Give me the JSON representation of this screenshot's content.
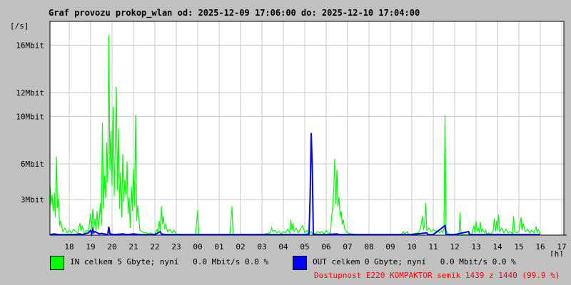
{
  "chart_data": {
    "type": "line",
    "title": "Graf provozu prokop_wlan od: 2025-12-09 17:06:00 do: 2025-12-10 17:04:00",
    "ylabel": "[/s]",
    "xlabel": "[h]",
    "ylim": [
      0,
      18
    ],
    "y_ticks": [
      {
        "value": 3,
        "label": "3Mbit"
      },
      {
        "value": 6,
        "label": "6Mbit"
      },
      {
        "value": 10,
        "label": "10Mbit"
      },
      {
        "value": 12,
        "label": "12Mbit"
      },
      {
        "value": 16,
        "label": "16Mbit"
      }
    ],
    "xlim": [
      17.1,
      17.1
    ],
    "x_hours": [
      "18",
      "19",
      "20",
      "21",
      "22",
      "23",
      "00",
      "01",
      "02",
      "03",
      "04",
      "05",
      "06",
      "07",
      "08",
      "09",
      "10",
      "11",
      "12",
      "13",
      "14",
      "15",
      "16",
      "17"
    ],
    "grid": true,
    "series": [
      {
        "name": "IN",
        "color": "#00ff00",
        "unit": "Mbit/s",
        "points": [
          [
            17.1,
            4.2
          ],
          [
            17.15,
            2.5
          ],
          [
            17.2,
            3.4
          ],
          [
            17.25,
            2.0
          ],
          [
            17.3,
            3.6
          ],
          [
            17.35,
            1.5
          ],
          [
            17.4,
            6.6
          ],
          [
            17.45,
            2.3
          ],
          [
            17.5,
            3.1
          ],
          [
            17.55,
            0.8
          ],
          [
            17.6,
            1.2
          ],
          [
            17.7,
            0.3
          ],
          [
            17.8,
            0.6
          ],
          [
            17.9,
            0.2
          ],
          [
            18.0,
            0.4
          ],
          [
            18.1,
            0.2
          ],
          [
            18.2,
            0.5
          ],
          [
            18.3,
            0.3
          ],
          [
            18.4,
            0.2
          ],
          [
            18.5,
            1.0
          ],
          [
            18.55,
            0.3
          ],
          [
            18.6,
            0.8
          ],
          [
            18.7,
            0.2
          ],
          [
            18.8,
            0.4
          ],
          [
            18.9,
            0.3
          ],
          [
            19.0,
            1.8
          ],
          [
            19.05,
            0.5
          ],
          [
            19.1,
            2.2
          ],
          [
            19.15,
            0.6
          ],
          [
            19.2,
            1.4
          ],
          [
            19.25,
            0.4
          ],
          [
            19.3,
            2.0
          ],
          [
            19.35,
            0.5
          ],
          [
            19.4,
            1.3
          ],
          [
            19.45,
            2.7
          ],
          [
            19.5,
            0.8
          ],
          [
            19.55,
            9.5
          ],
          [
            19.6,
            2.2
          ],
          [
            19.65,
            5.0
          ],
          [
            19.7,
            3.1
          ],
          [
            19.75,
            7.8
          ],
          [
            19.8,
            4.4
          ],
          [
            19.85,
            16.8
          ],
          [
            19.9,
            5.5
          ],
          [
            19.95,
            8.8
          ],
          [
            20.0,
            4.2
          ],
          [
            20.05,
            10.8
          ],
          [
            20.1,
            3.3
          ],
          [
            20.15,
            7.5
          ],
          [
            20.2,
            12.5
          ],
          [
            20.25,
            3.8
          ],
          [
            20.3,
            9.0
          ],
          [
            20.35,
            2.2
          ],
          [
            20.4,
            5.3
          ],
          [
            20.45,
            1.5
          ],
          [
            20.5,
            6.8
          ],
          [
            20.55,
            2.8
          ],
          [
            20.6,
            4.7
          ],
          [
            20.65,
            3.4
          ],
          [
            20.7,
            6.2
          ],
          [
            20.75,
            1.8
          ],
          [
            20.8,
            3.2
          ],
          [
            20.85,
            0.6
          ],
          [
            20.9,
            4.1
          ],
          [
            20.95,
            2.0
          ],
          [
            21.0,
            5.6
          ],
          [
            21.05,
            2.4
          ],
          [
            21.1,
            10.1
          ],
          [
            21.15,
            1.2
          ],
          [
            21.2,
            2.5
          ],
          [
            21.3,
            0.4
          ],
          [
            21.4,
            0.3
          ],
          [
            21.5,
            0.2
          ],
          [
            21.6,
            0.2
          ],
          [
            21.7,
            0.1
          ],
          [
            21.8,
            0.2
          ],
          [
            21.9,
            0.1
          ],
          [
            22.0,
            0.1
          ],
          [
            22.1,
            0.5
          ],
          [
            22.15,
            0.2
          ],
          [
            22.2,
            1.2
          ],
          [
            22.25,
            0.4
          ],
          [
            22.3,
            2.4
          ],
          [
            22.35,
            0.9
          ],
          [
            22.4,
            1.6
          ],
          [
            22.45,
            0.5
          ],
          [
            22.5,
            0.9
          ],
          [
            22.6,
            0.3
          ],
          [
            22.7,
            0.5
          ],
          [
            22.8,
            0.2
          ],
          [
            22.9,
            0.4
          ],
          [
            23.0,
            0.1
          ],
          [
            23.2,
            0.05
          ],
          [
            23.5,
            0.05
          ],
          [
            23.9,
            0.05
          ],
          [
            24.0,
            2.1
          ],
          [
            24.05,
            0.05
          ],
          [
            24.5,
            0.05
          ],
          [
            25.0,
            0.05
          ],
          [
            25.5,
            0.05
          ],
          [
            25.6,
            2.4
          ],
          [
            25.65,
            0.05
          ],
          [
            26.0,
            0.05
          ],
          [
            26.5,
            0.05
          ],
          [
            27.0,
            0.05
          ],
          [
            27.4,
            0.2
          ],
          [
            27.45,
            0.6
          ],
          [
            27.5,
            0.3
          ],
          [
            27.6,
            0.4
          ],
          [
            27.7,
            0.2
          ],
          [
            27.8,
            0.3
          ],
          [
            27.9,
            0.1
          ],
          [
            28.0,
            0.3
          ],
          [
            28.1,
            0.2
          ],
          [
            28.2,
            0.5
          ],
          [
            28.3,
            0.2
          ],
          [
            28.35,
            1.3
          ],
          [
            28.4,
            0.4
          ],
          [
            28.45,
            1.0
          ],
          [
            28.5,
            0.3
          ],
          [
            28.6,
            0.6
          ],
          [
            28.7,
            0.2
          ],
          [
            28.8,
            0.5
          ],
          [
            28.9,
            0.8
          ],
          [
            29.0,
            0.2
          ],
          [
            29.1,
            0.4
          ],
          [
            29.2,
            0.1
          ],
          [
            29.3,
            0.3
          ],
          [
            29.35,
            0.1
          ],
          [
            29.4,
            0.2
          ],
          [
            29.5,
            0.1
          ],
          [
            29.6,
            0.3
          ],
          [
            29.7,
            0.2
          ],
          [
            29.8,
            0.3
          ],
          [
            29.9,
            0.1
          ],
          [
            30.0,
            0.4
          ],
          [
            30.1,
            0.2
          ],
          [
            30.2,
            0.1
          ],
          [
            30.25,
            1.5
          ],
          [
            30.3,
            2.2
          ],
          [
            30.35,
            3.8
          ],
          [
            30.4,
            6.4
          ],
          [
            30.45,
            2.6
          ],
          [
            30.5,
            5.5
          ],
          [
            30.55,
            2.4
          ],
          [
            30.6,
            3.2
          ],
          [
            30.65,
            1.6
          ],
          [
            30.7,
            2.0
          ],
          [
            30.75,
            0.9
          ],
          [
            30.8,
            1.3
          ],
          [
            30.85,
            0.6
          ],
          [
            30.9,
            0.4
          ],
          [
            31.0,
            0.2
          ],
          [
            31.2,
            0.1
          ],
          [
            31.5,
            0.05
          ],
          [
            32.0,
            0.05
          ],
          [
            32.5,
            0.05
          ],
          [
            33.0,
            0.05
          ],
          [
            33.5,
            0.05
          ],
          [
            33.6,
            0.3
          ],
          [
            33.65,
            0.1
          ],
          [
            33.8,
            0.3
          ],
          [
            33.85,
            0.05
          ],
          [
            34.0,
            0.1
          ],
          [
            34.3,
            0.2
          ],
          [
            34.4,
            0.5
          ],
          [
            34.5,
            1.6
          ],
          [
            34.55,
            0.4
          ],
          [
            34.6,
            1.0
          ],
          [
            34.65,
            2.7
          ],
          [
            34.7,
            0.4
          ],
          [
            34.8,
            0.6
          ],
          [
            34.9,
            0.3
          ],
          [
            35.0,
            0.5
          ],
          [
            35.1,
            0.3
          ],
          [
            35.2,
            0.4
          ],
          [
            35.3,
            0.2
          ],
          [
            35.4,
            0.4
          ],
          [
            35.45,
            0.2
          ],
          [
            35.5,
            0.5
          ],
          [
            35.55,
            10.1
          ],
          [
            35.6,
            0.4
          ],
          [
            35.7,
            0.1
          ],
          [
            35.8,
            0.05
          ],
          [
            36.0,
            0.05
          ],
          [
            36.2,
            0.05
          ],
          [
            36.25,
            1.9
          ],
          [
            36.3,
            0.05
          ],
          [
            36.6,
            0.05
          ],
          [
            36.8,
            0.1
          ],
          [
            36.9,
            0.8
          ],
          [
            36.95,
            0.2
          ],
          [
            37.0,
            1.2
          ],
          [
            37.05,
            0.3
          ],
          [
            37.1,
            0.6
          ],
          [
            37.15,
            0.2
          ],
          [
            37.2,
            1.1
          ],
          [
            37.25,
            0.3
          ],
          [
            37.3,
            0.5
          ],
          [
            37.4,
            0.2
          ],
          [
            37.45,
            0.4
          ],
          [
            37.5,
            0.1
          ],
          [
            37.6,
            0.2
          ],
          [
            37.7,
            0.1
          ],
          [
            37.8,
            0.4
          ],
          [
            37.85,
            1.4
          ],
          [
            37.9,
            0.3
          ],
          [
            37.95,
            1.2
          ],
          [
            38.0,
            0.4
          ],
          [
            38.05,
            1.7
          ],
          [
            38.1,
            0.3
          ],
          [
            38.2,
            0.6
          ],
          [
            38.3,
            0.2
          ],
          [
            38.4,
            0.5
          ],
          [
            38.5,
            0.2
          ],
          [
            38.6,
            0.3
          ],
          [
            38.7,
            0.1
          ],
          [
            38.75,
            1.6
          ],
          [
            38.8,
            0.3
          ],
          [
            38.9,
            0.2
          ],
          [
            39.0,
            0.3
          ],
          [
            39.1,
            1.5
          ],
          [
            39.15,
            0.4
          ],
          [
            39.2,
            1.0
          ],
          [
            39.3,
            0.3
          ],
          [
            39.4,
            0.5
          ],
          [
            39.5,
            0.2
          ],
          [
            39.6,
            0.4
          ],
          [
            39.7,
            0.2
          ],
          [
            39.8,
            0.7
          ],
          [
            39.85,
            0.2
          ],
          [
            39.9,
            0.5
          ],
          [
            40.0,
            0.1
          ]
        ]
      },
      {
        "name": "OUT",
        "color": "#0000ff",
        "unit": "Mbit/s",
        "points": [
          [
            17.1,
            0.05
          ],
          [
            17.3,
            0.1
          ],
          [
            17.5,
            0.05
          ],
          [
            17.8,
            0.05
          ],
          [
            18.2,
            0.05
          ],
          [
            18.5,
            0.1
          ],
          [
            18.6,
            0.05
          ],
          [
            18.9,
            0.2
          ],
          [
            19.0,
            0.4
          ],
          [
            19.05,
            0.1
          ],
          [
            19.1,
            0.5
          ],
          [
            19.15,
            0.2
          ],
          [
            19.2,
            0.3
          ],
          [
            19.4,
            0.1
          ],
          [
            19.5,
            0.15
          ],
          [
            19.8,
            0.05
          ],
          [
            19.85,
            0.7
          ],
          [
            19.9,
            0.1
          ],
          [
            20.1,
            0.05
          ],
          [
            20.5,
            0.1
          ],
          [
            20.7,
            0.05
          ],
          [
            21.0,
            0.1
          ],
          [
            21.3,
            0.05
          ],
          [
            22.0,
            0.05
          ],
          [
            22.25,
            0.3
          ],
          [
            22.3,
            0.1
          ],
          [
            22.5,
            0.05
          ],
          [
            23.0,
            0.05
          ],
          [
            24.0,
            0.05
          ],
          [
            25.0,
            0.05
          ],
          [
            26.0,
            0.05
          ],
          [
            27.0,
            0.05
          ],
          [
            28.0,
            0.05
          ],
          [
            29.0,
            0.05
          ],
          [
            29.2,
            0.1
          ],
          [
            29.25,
            3.2
          ],
          [
            29.3,
            8.6
          ],
          [
            29.35,
            5.8
          ],
          [
            29.4,
            0.05
          ],
          [
            29.8,
            0.05
          ],
          [
            30.0,
            0.05
          ],
          [
            30.5,
            0.1
          ],
          [
            30.6,
            0.05
          ],
          [
            31.0,
            0.05
          ],
          [
            31.5,
            0.05
          ],
          [
            32.0,
            0.05
          ],
          [
            33.0,
            0.05
          ],
          [
            34.0,
            0.05
          ],
          [
            34.7,
            0.2
          ],
          [
            34.75,
            0.05
          ],
          [
            35.0,
            0.05
          ],
          [
            35.55,
            0.8
          ],
          [
            35.6,
            0.05
          ],
          [
            36.0,
            0.05
          ],
          [
            36.65,
            0.3
          ],
          [
            36.7,
            0.05
          ],
          [
            37.0,
            0.05
          ],
          [
            38.0,
            0.05
          ],
          [
            39.0,
            0.05
          ],
          [
            40.0,
            0.05
          ]
        ]
      }
    ]
  },
  "legend": {
    "in_text": "IN celkem 5 Gbyte; nyní   0.0 Mbit/s 0.0 %",
    "out_text": "OUT celkem 0 Gbyte; nyní   0.0 Mbit/s 0.0 %",
    "in_color": "#00ff00",
    "out_color": "#0000ff"
  },
  "availability": {
    "text": "Dostupnost E220 KOMPAKTOR semik 1439 z 1440 (99.9 %)",
    "color": "#ff0000"
  }
}
